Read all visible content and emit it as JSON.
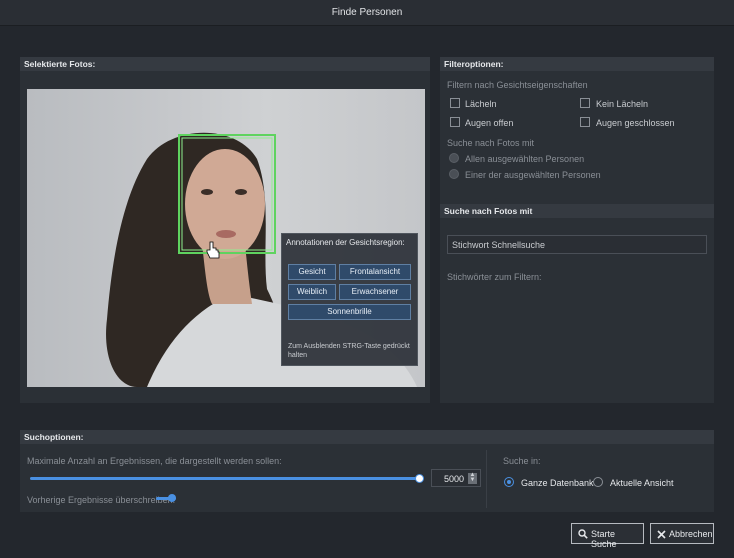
{
  "window": {
    "title": "Finde Personen"
  },
  "selected_photos": {
    "header": "Selektierte Fotos:"
  },
  "annotation_popup": {
    "title": "Annotationen der Gesichtsregion:",
    "tags": [
      "Gesicht",
      "Frontalansicht",
      "Weiblich",
      "Erwachsener",
      "Sonnenbrille"
    ],
    "hint": "Zum Ausblenden STRG-Taste gedrückt halten"
  },
  "filter": {
    "header": "Filteroptionen:",
    "face_props_label": "Filtern nach Gesichtseigenschaften",
    "checkboxes": [
      "Lächeln",
      "Kein Lächeln",
      "Augen offen",
      "Augen geschlossen"
    ],
    "search_photos_with_label": "Suche nach Fotos mit",
    "radios": [
      "Allen ausgewählten Personen",
      "Einer der ausgewählten Personen"
    ]
  },
  "search": {
    "header": "Suche nach Fotos mit",
    "input_value": "Stichwort Schnellsuche",
    "keywords_label": "Stichwörter zum Filtern:"
  },
  "search_options": {
    "header": "Suchoptionen:",
    "max_results_label": "Maximale Anzahl an Ergebnissen, die dargestellt werden sollen:",
    "max_results_value": "5000",
    "slider_fraction": 1.0,
    "overwrite_label": "Vorherige Ergebnisse überschreiben:",
    "overwrite_on": true,
    "search_in_label": "Suche in:",
    "search_in_options": [
      "Ganze Datenbank",
      "Aktuelle Ansicht"
    ],
    "search_in_selected": "Ganze Datenbank"
  },
  "footer": {
    "start_search": "Starte Suche",
    "cancel": "Abbrechen"
  },
  "colors": {
    "accent": "#4a90e2",
    "face_box": "#5fd35f"
  }
}
